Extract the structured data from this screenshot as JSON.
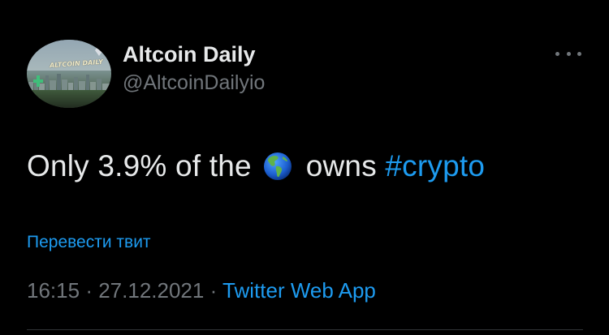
{
  "author": {
    "name": "Altcoin Daily",
    "handle": "@AltcoinDailyio",
    "avatar_text": "ALTCOIN DAILY"
  },
  "tweet": {
    "text_before": "Only 3.9% of the",
    "emoji_icon": "globe-americas-icon",
    "text_after": "owns",
    "hashtag": "#crypto"
  },
  "translate_label": "Перевести твит",
  "meta": {
    "time": "16:15",
    "separator": "·",
    "date": "27.12.2021",
    "source": "Twitter Web App"
  },
  "colors": {
    "background": "#000000",
    "text": "#e7e9ea",
    "secondary": "#71767b",
    "accent": "#1d9bf0"
  }
}
